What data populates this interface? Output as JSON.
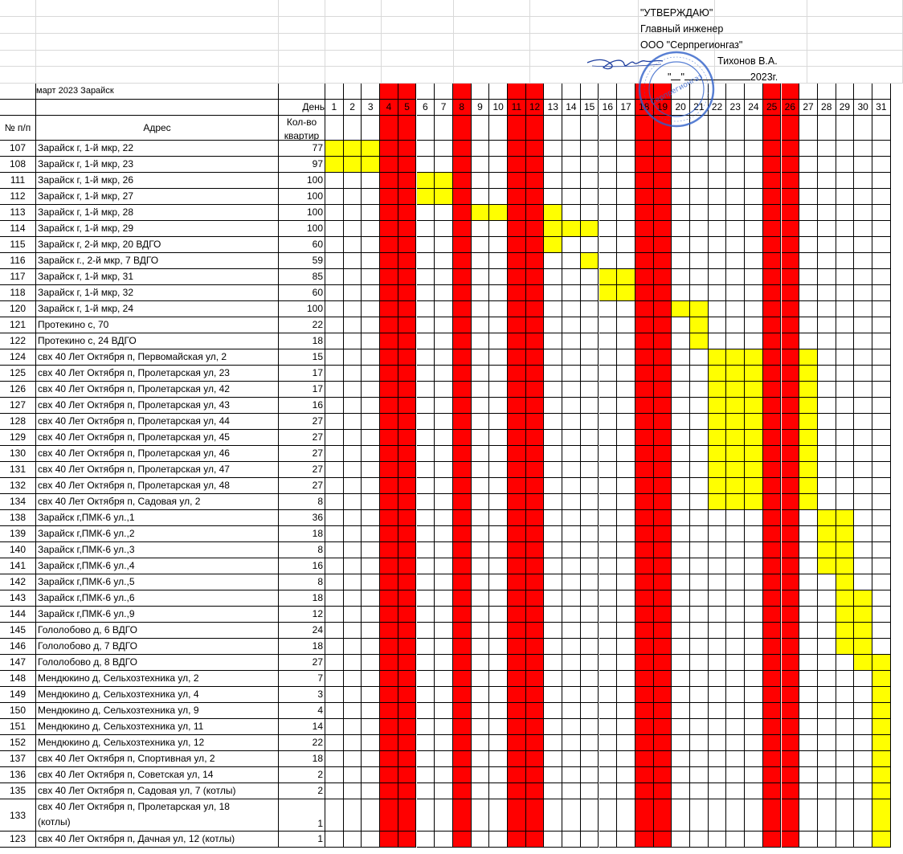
{
  "approval": {
    "line1": "\"УТВЕРЖДАЮ\"",
    "line2": "Главный инженер",
    "line3": "ООО \"Серпрегионгаз\"",
    "line4": "Тихонов В.А.",
    "date_quote_open": "\"",
    "date_quote_close": "\"",
    "date_year": "2023г."
  },
  "stamp_text": "Серпрегионгаз",
  "header": {
    "period": "март 2023 Зарайск",
    "day_label": "День",
    "num_label": "№ п/п",
    "address_label": "Адрес",
    "qty_label": "Кол-во квартир"
  },
  "days": [
    1,
    2,
    3,
    4,
    5,
    6,
    7,
    8,
    9,
    10,
    11,
    12,
    13,
    14,
    15,
    16,
    17,
    18,
    19,
    20,
    21,
    22,
    23,
    24,
    25,
    26,
    27,
    28,
    29,
    30,
    31
  ],
  "weekend_days": [
    4,
    5,
    8,
    11,
    12,
    18,
    19,
    25,
    26
  ],
  "colors": {
    "weekend": "#ff0000",
    "scheduled": "#ffff00"
  },
  "rows": [
    {
      "num": "107",
      "addr": "Зарайск г, 1-й мкр, 22",
      "qty": "77",
      "days": [
        1,
        2,
        3
      ]
    },
    {
      "num": "108",
      "addr": "Зарайск г, 1-й мкр, 23",
      "qty": "97",
      "days": [
        1,
        2,
        3
      ]
    },
    {
      "num": "111",
      "addr": "Зарайск г, 1-й мкр, 26",
      "qty": "100",
      "days": [
        6,
        7
      ]
    },
    {
      "num": "112",
      "addr": "Зарайск г, 1-й мкр, 27",
      "qty": "100",
      "days": [
        6,
        7
      ]
    },
    {
      "num": "113",
      "addr": "Зарайск г, 1-й мкр, 28",
      "qty": "100",
      "days": [
        9,
        10,
        13
      ]
    },
    {
      "num": "114",
      "addr": "Зарайск г, 1-й мкр, 29",
      "qty": "100",
      "days": [
        13,
        14,
        15
      ]
    },
    {
      "num": "115",
      "addr": "Зарайск г,  2-й мкр, 20 ВДГО",
      "qty": "60",
      "days": [
        13
      ]
    },
    {
      "num": "116",
      "addr": "Зарайск г., 2-й мкр, 7 ВДГО",
      "qty": "59",
      "days": [
        15
      ]
    },
    {
      "num": "117",
      "addr": "Зарайск г, 1-й мкр, 31",
      "qty": "85",
      "days": [
        16,
        17
      ]
    },
    {
      "num": "118",
      "addr": "Зарайск г, 1-й мкр, 32",
      "qty": "60",
      "days": [
        16,
        17
      ]
    },
    {
      "num": "120",
      "addr": "Зарайск г, 1-й мкр, 24",
      "qty": "100",
      "days": [
        20,
        21
      ]
    },
    {
      "num": "121",
      "addr": "Протекино с, 70",
      "qty": "22",
      "days": [
        21
      ]
    },
    {
      "num": "122",
      "addr": "Протекино с, 24 ВДГО",
      "qty": "18",
      "days": [
        21
      ]
    },
    {
      "num": "124",
      "addr": " свх 40 Лет Октября п, Первомайская ул, 2",
      "qty": "15",
      "days": [
        22,
        23,
        24,
        27
      ]
    },
    {
      "num": "125",
      "addr": " свх 40 Лет Октября п, Пролетарская ул, 23",
      "qty": "17",
      "days": [
        22,
        23,
        24,
        27
      ]
    },
    {
      "num": "126",
      "addr": " свх 40 Лет Октября п, Пролетарская ул, 42",
      "qty": "17",
      "days": [
        22,
        23,
        24,
        27
      ]
    },
    {
      "num": "127",
      "addr": " свх 40 Лет Октября п, Пролетарская ул, 43",
      "qty": "16",
      "days": [
        22,
        23,
        24,
        27
      ]
    },
    {
      "num": "128",
      "addr": " свх 40 Лет Октября п, Пролетарская ул, 44",
      "qty": "27",
      "days": [
        22,
        23,
        24,
        27
      ]
    },
    {
      "num": "129",
      "addr": " свх 40 Лет Октября п, Пролетарская ул, 45",
      "qty": "27",
      "days": [
        22,
        23,
        24,
        27
      ]
    },
    {
      "num": "130",
      "addr": " свх 40 Лет Октября п, Пролетарская ул, 46",
      "qty": "27",
      "days": [
        22,
        23,
        24,
        27
      ]
    },
    {
      "num": "131",
      "addr": " свх 40 Лет Октября п, Пролетарская ул, 47",
      "qty": "27",
      "days": [
        22,
        23,
        24,
        27
      ]
    },
    {
      "num": "132",
      "addr": " свх 40 Лет Октября п, Пролетарская ул, 48",
      "qty": "27",
      "days": [
        22,
        23,
        24,
        27
      ]
    },
    {
      "num": "134",
      "addr": " свх 40 Лет Октября п, Садовая ул, 2",
      "qty": "8",
      "days": [
        22,
        23,
        24,
        27
      ]
    },
    {
      "num": "138",
      "addr": "Зарайск г,ПМК-6 ул.,1",
      "qty": "36",
      "days": [
        28,
        29
      ]
    },
    {
      "num": "139",
      "addr": "Зарайск г,ПМК-6 ул.,2",
      "qty": "18",
      "days": [
        28,
        29
      ]
    },
    {
      "num": "140",
      "addr": "Зарайск г,ПМК-6 ул.,3",
      "qty": "8",
      "days": [
        28,
        29
      ]
    },
    {
      "num": "141",
      "addr": "Зарайск г,ПМК-6 ул.,4",
      "qty": "16",
      "days": [
        28,
        29
      ]
    },
    {
      "num": "142",
      "addr": "Зарайск г,ПМК-6 ул.,5",
      "qty": "8",
      "days": [
        29
      ]
    },
    {
      "num": "143",
      "addr": "Зарайск г,ПМК-6 ул.,6",
      "qty": "18",
      "days": [
        29,
        30
      ]
    },
    {
      "num": "144",
      "addr": "Зарайск г,ПМК-6 ул.,9",
      "qty": "12",
      "days": [
        29,
        30
      ]
    },
    {
      "num": "145",
      "addr": "Гололобово д, 6 ВДГО",
      "qty": "24",
      "days": [
        29,
        30
      ]
    },
    {
      "num": "146",
      "addr": "Гололобово д, 7 ВДГО",
      "qty": "18",
      "days": [
        29,
        30
      ]
    },
    {
      "num": "147",
      "addr": "Гололобово д, 8 ВДГО",
      "qty": "27",
      "days": [
        30,
        31
      ]
    },
    {
      "num": "148",
      "addr": "Мендюкино д, Сельхозтехника ул, 2",
      "qty": "7",
      "days": [
        31
      ]
    },
    {
      "num": "149",
      "addr": "Мендюкино д, Сельхозтехника ул, 4",
      "qty": "3",
      "days": [
        31
      ]
    },
    {
      "num": "150",
      "addr": "Мендюкино д, Сельхозтехника ул, 9",
      "qty": "4",
      "days": [
        31
      ]
    },
    {
      "num": "151",
      "addr": "Мендюкино д, Сельхозтехника ул, 11",
      "qty": "14",
      "days": [
        31
      ]
    },
    {
      "num": "152",
      "addr": "Мендюкино д, Сельхозтехника ул, 12",
      "qty": "22",
      "days": [
        31
      ]
    },
    {
      "num": "137",
      "addr": " свх 40 Лет Октября п, Спортивная ул, 2",
      "qty": "18",
      "days": [
        31
      ]
    },
    {
      "num": "136",
      "addr": " свх 40 Лет Октября п, Советская ул, 14",
      "qty": "2",
      "days": [
        31
      ]
    },
    {
      "num": "135",
      "addr": " свх 40 Лет Октября п, Садовая ул, 7 (котлы)",
      "qty": "2",
      "days": [
        31
      ]
    },
    {
      "num": "133",
      "addr": " свх 40 Лет Октября п, Пролетарская ул, 18",
      "addr2": "(котлы)",
      "qty": "1",
      "days": [
        31
      ]
    },
    {
      "num": "123",
      "addr": " свх 40 Лет Октября п, Дачная ул, 12 (котлы)",
      "qty": "1",
      "days": [
        31
      ]
    }
  ]
}
